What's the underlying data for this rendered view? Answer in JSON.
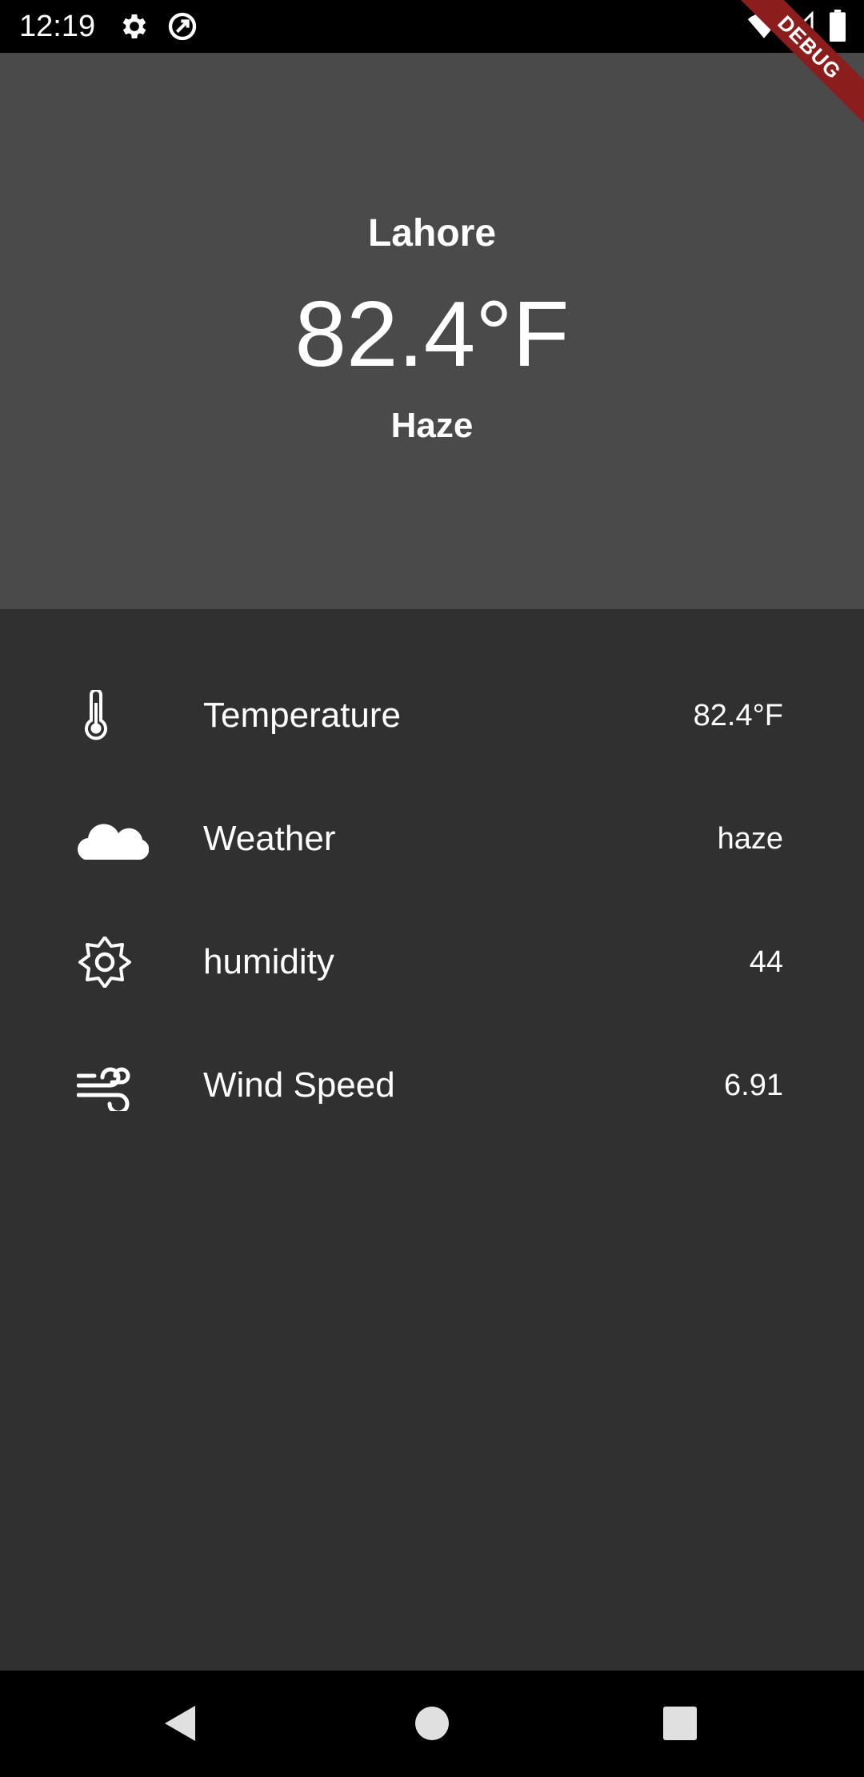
{
  "status_bar": {
    "time": "12:19",
    "icons": [
      "settings-icon",
      "data-saver-icon",
      "wifi-icon",
      "signal-icon",
      "battery-icon"
    ]
  },
  "debug_banner": "DEBUG",
  "header": {
    "city": "Lahore",
    "temperature": "82.4°F",
    "description": "Haze",
    "background": "#4a4a4a"
  },
  "details": [
    {
      "icon": "thermometer-icon",
      "label": "Temperature",
      "value": "82.4°F"
    },
    {
      "icon": "cloud-icon",
      "label": "Weather",
      "value": "haze"
    },
    {
      "icon": "sun-gear-icon",
      "label": "humidity",
      "value": "44"
    },
    {
      "icon": "wind-icon",
      "label": "Wind Speed",
      "value": "6.91"
    }
  ],
  "nav_bar": {
    "buttons": [
      "back-icon",
      "home-icon",
      "recents-icon"
    ]
  },
  "colors": {
    "background": "#303030",
    "header": "#4a4a4a",
    "debug": "#8b1d1d",
    "text": "#ffffff"
  }
}
